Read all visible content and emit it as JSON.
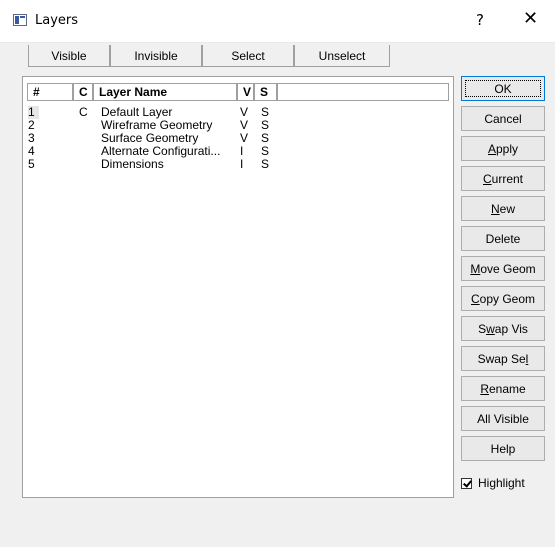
{
  "window": {
    "title": "Layers",
    "help_glyph": "?",
    "close_glyph": "✕"
  },
  "visibility_buttons": [
    {
      "label": "Visible"
    },
    {
      "label": "Invisible"
    },
    {
      "label": "Select"
    },
    {
      "label": "Unselect"
    }
  ],
  "table": {
    "columns": [
      "#",
      "C",
      "Layer Name",
      "V",
      "S"
    ],
    "rows": [
      {
        "num": "1",
        "c": "C",
        "name": "Default Layer",
        "v": "V",
        "s": "S"
      },
      {
        "num": "2",
        "c": "",
        "name": "Wireframe Geometry",
        "v": "V",
        "s": "S"
      },
      {
        "num": "3",
        "c": "",
        "name": "Surface Geometry",
        "v": "V",
        "s": "S"
      },
      {
        "num": "4",
        "c": "",
        "name": "Alternate Configurati...",
        "v": "I",
        "s": "S"
      },
      {
        "num": "5",
        "c": "",
        "name": "Dimensions",
        "v": "I",
        "s": "S"
      }
    ]
  },
  "side_buttons": [
    {
      "id": "ok",
      "label": "OK",
      "pre": "",
      "key": "",
      "post": "OK"
    },
    {
      "id": "cancel",
      "label": "Cancel",
      "pre": "",
      "key": "",
      "post": "Cancel"
    },
    {
      "id": "apply",
      "label": "Apply",
      "pre": "",
      "key": "A",
      "post": "pply"
    },
    {
      "id": "current",
      "label": "Current",
      "pre": "",
      "key": "C",
      "post": "urrent"
    },
    {
      "id": "new",
      "label": "New",
      "pre": "",
      "key": "N",
      "post": "ew"
    },
    {
      "id": "delete",
      "label": "Delete",
      "pre": "",
      "key": "",
      "post": "Delete"
    },
    {
      "id": "move-geom",
      "label": "Move Geom",
      "pre": "",
      "key": "M",
      "post": "ove Geom"
    },
    {
      "id": "copy-geom",
      "label": "Copy Geom",
      "pre": "",
      "key": "C",
      "post": "opy Geom"
    },
    {
      "id": "swap-vis",
      "label": "Swap Vis",
      "pre": "S",
      "key": "w",
      "post": "ap Vis"
    },
    {
      "id": "swap-sel",
      "label": "Swap Sel",
      "pre": "Swap Se",
      "key": "l",
      "post": ""
    },
    {
      "id": "rename",
      "label": "Rename",
      "pre": "",
      "key": "R",
      "post": "ename"
    },
    {
      "id": "all-visible",
      "label": "All Visible",
      "pre": "",
      "key": "",
      "post": "All Visible"
    },
    {
      "id": "help",
      "label": "Help",
      "pre": "",
      "key": "",
      "post": "Help"
    }
  ],
  "highlight": {
    "label": "Highlight",
    "checked": true
  }
}
